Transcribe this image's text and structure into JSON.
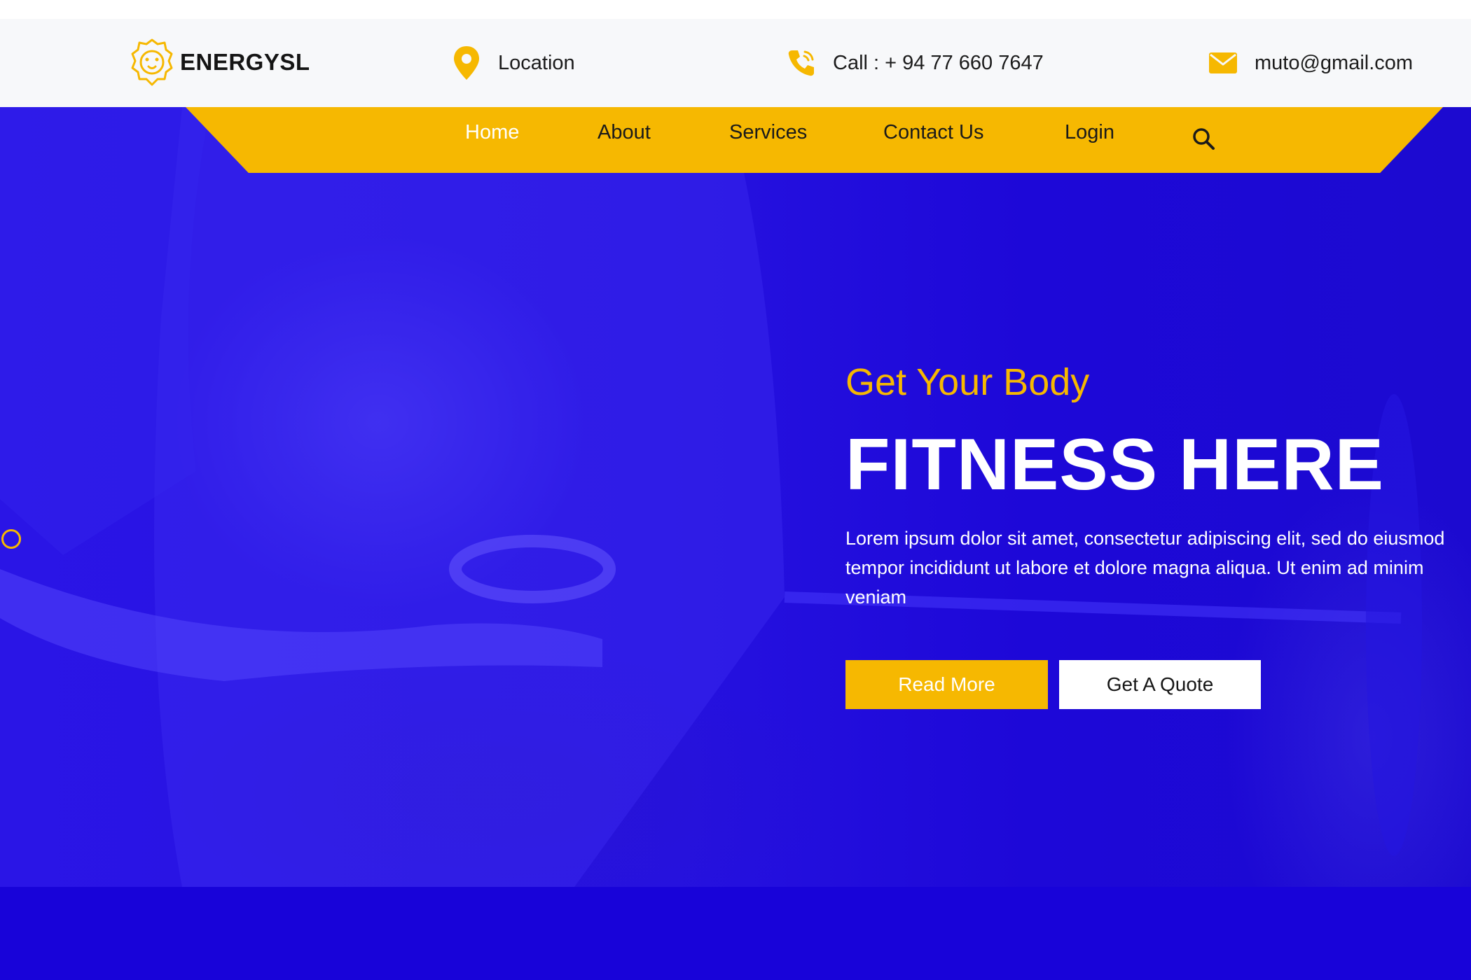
{
  "brand": {
    "name": "ENERGYSL",
    "logo_icon": "lion-icon"
  },
  "contact": {
    "location": {
      "icon": "location-pin-icon",
      "text": "Location"
    },
    "phone": {
      "icon": "phone-icon",
      "text": "Call : + 94 77 660 7647"
    },
    "email": {
      "icon": "mail-icon",
      "text": "muto@gmail.com"
    }
  },
  "nav": {
    "items": [
      {
        "label": "Home",
        "active": true
      },
      {
        "label": "About",
        "active": false
      },
      {
        "label": "Services",
        "active": false
      },
      {
        "label": "Contact Us",
        "active": false
      },
      {
        "label": "Login",
        "active": false
      }
    ],
    "search_icon": "search-icon"
  },
  "hero": {
    "subtitle": "Get Your Body",
    "title": "FITNESS HERE",
    "description": "Lorem ipsum dolor sit amet, consectetur adipiscing elit, sed do eiusmod tempor incididunt ut labore et dolore magna aliqua. Ut enim ad minim veniam",
    "buttons": {
      "read_more": "Read More",
      "quote": "Get A Quote"
    }
  },
  "colors": {
    "accent": "#f6b801",
    "hero_blue": "#2612e0",
    "topbar_bg": "#f7f8fa",
    "text_dark": "#1b1b1b"
  }
}
